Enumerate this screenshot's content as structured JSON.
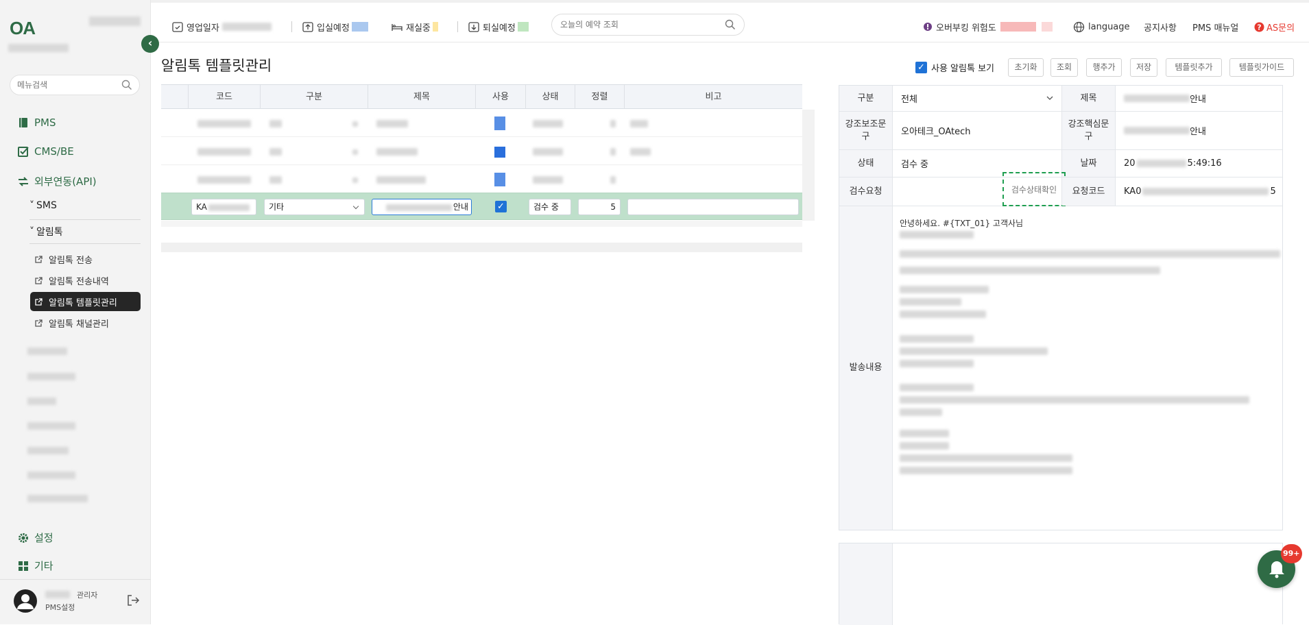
{
  "brand": {
    "logo_text": "OA"
  },
  "sidebar": {
    "search_placeholder": "메뉴검색",
    "menu": [
      {
        "label": "PMS",
        "icon": "book-icon"
      },
      {
        "label": "CMS/BE",
        "icon": "check-square-icon"
      },
      {
        "label": "외부연동(API)",
        "icon": "link-arrows-icon"
      }
    ],
    "submenu": [
      {
        "label": "SMS",
        "prefix": "˅"
      },
      {
        "label": "알림톡",
        "prefix": "˅"
      }
    ],
    "alimtalk_items": [
      {
        "label": "알림톡 전송",
        "active": false
      },
      {
        "label": "알림톡 전송내역",
        "active": false
      },
      {
        "label": "알림톡 템플릿관리",
        "active": true
      },
      {
        "label": "알림톡 채널관리",
        "active": false
      }
    ],
    "bottom_menu": [
      {
        "label": "설정",
        "icon": "gear-icon"
      },
      {
        "label": "기타",
        "icon": "grid-icon"
      }
    ],
    "user": {
      "role": "관리자",
      "subtitle": "PMS설정"
    }
  },
  "topbar": {
    "business_date_label": "영업일자",
    "checkin_label": "입실예정",
    "inhouse_label": "재실중",
    "checkout_label": "퇴실예정",
    "search_placeholder": "오늘의 예약 조회",
    "overbooking_label": "오버부킹 위험도",
    "language_label": "language",
    "notice_label": "공지사항",
    "manual_label": "PMS 매뉴얼",
    "as_label": "AS문의",
    "colors": {
      "checkin": "#aac8ef",
      "inhouse": "#fde6a0",
      "checkout": "#bfe6bf",
      "overbooking": "#f7b9b9",
      "as": "#e6392f"
    }
  },
  "page": {
    "title": "알림톡 템플릿관리",
    "show_used_label": "사용 알림톡 보기",
    "show_used_checked": true,
    "buttons": [
      "초기화",
      "조회",
      "행추가",
      "저장",
      "템플릿추가",
      "템플릿가이드"
    ]
  },
  "grid": {
    "columns": [
      "코드",
      "구분",
      "제목",
      "사용",
      "상태",
      "정렬",
      "비고"
    ],
    "selected_row": {
      "code": "KA",
      "category": "기타",
      "title_suffix": "안내",
      "use_checked": true,
      "status": "검수 중",
      "order": "5",
      "note": ""
    }
  },
  "form": {
    "category_label": "구분",
    "category_value": "전체",
    "title_label": "제목",
    "title_value_suffix": "안내",
    "sub_emphasis_label": "강조보조문구",
    "sub_emphasis_value": "오아테크_OAtech",
    "core_emphasis_label": "강조핵심문구",
    "core_emphasis_suffix": "안내",
    "status_label": "상태",
    "status_value": "검수 중",
    "date_label": "날짜",
    "date_prefix": "20",
    "date_suffix": "5:49:16",
    "review_request_label": "검수요청",
    "review_check_button": "검수상태확인",
    "request_code_label": "요청코드",
    "request_code_prefix": "KA0",
    "request_code_suffix": "5",
    "content_label": "발송내용",
    "content_first_line": "안녕하세요. #{TXT_01} 고객사님"
  },
  "notifications": {
    "badge": "99+"
  }
}
